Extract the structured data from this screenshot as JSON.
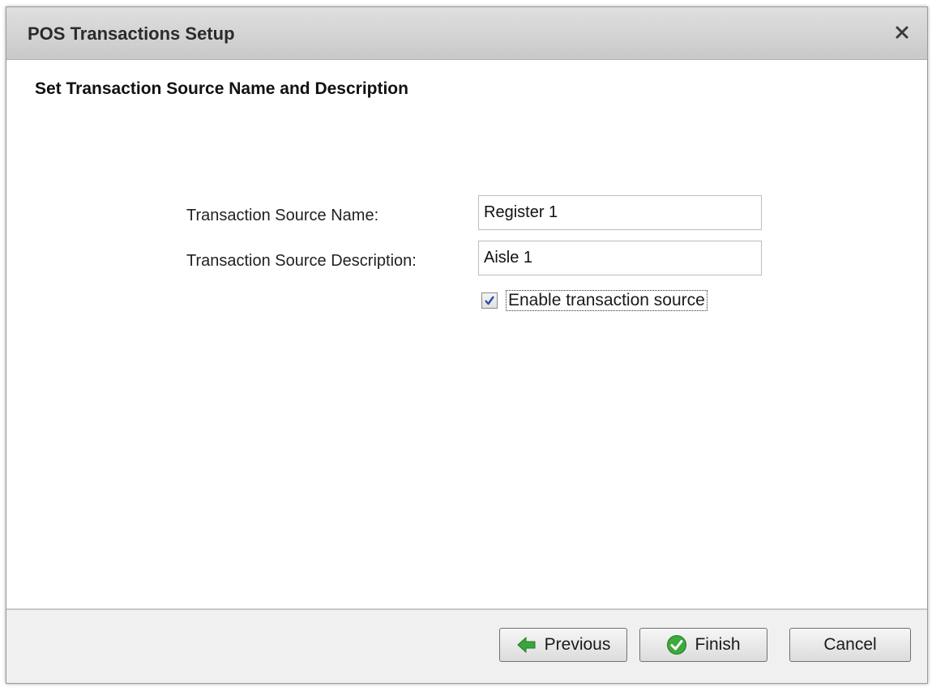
{
  "dialog": {
    "title": "POS Transactions Setup",
    "close_icon": "close-icon"
  },
  "page": {
    "heading": "Set Transaction Source Name and Description"
  },
  "form": {
    "name_label": "Transaction Source Name:",
    "name_value": "Register 1",
    "description_label": "Transaction Source Description:",
    "description_value": "Aisle 1",
    "enable_label": "Enable transaction source",
    "enable_checked": true
  },
  "footer": {
    "previous_label": "Previous",
    "previous_icon": "arrow-left-icon",
    "finish_label": "Finish",
    "finish_icon": "check-circle-icon",
    "cancel_label": "Cancel"
  },
  "colors": {
    "previous_icon": "#3aa53a",
    "finish_icon": "#3daa3d",
    "checkmark": "#2a4fa8"
  }
}
